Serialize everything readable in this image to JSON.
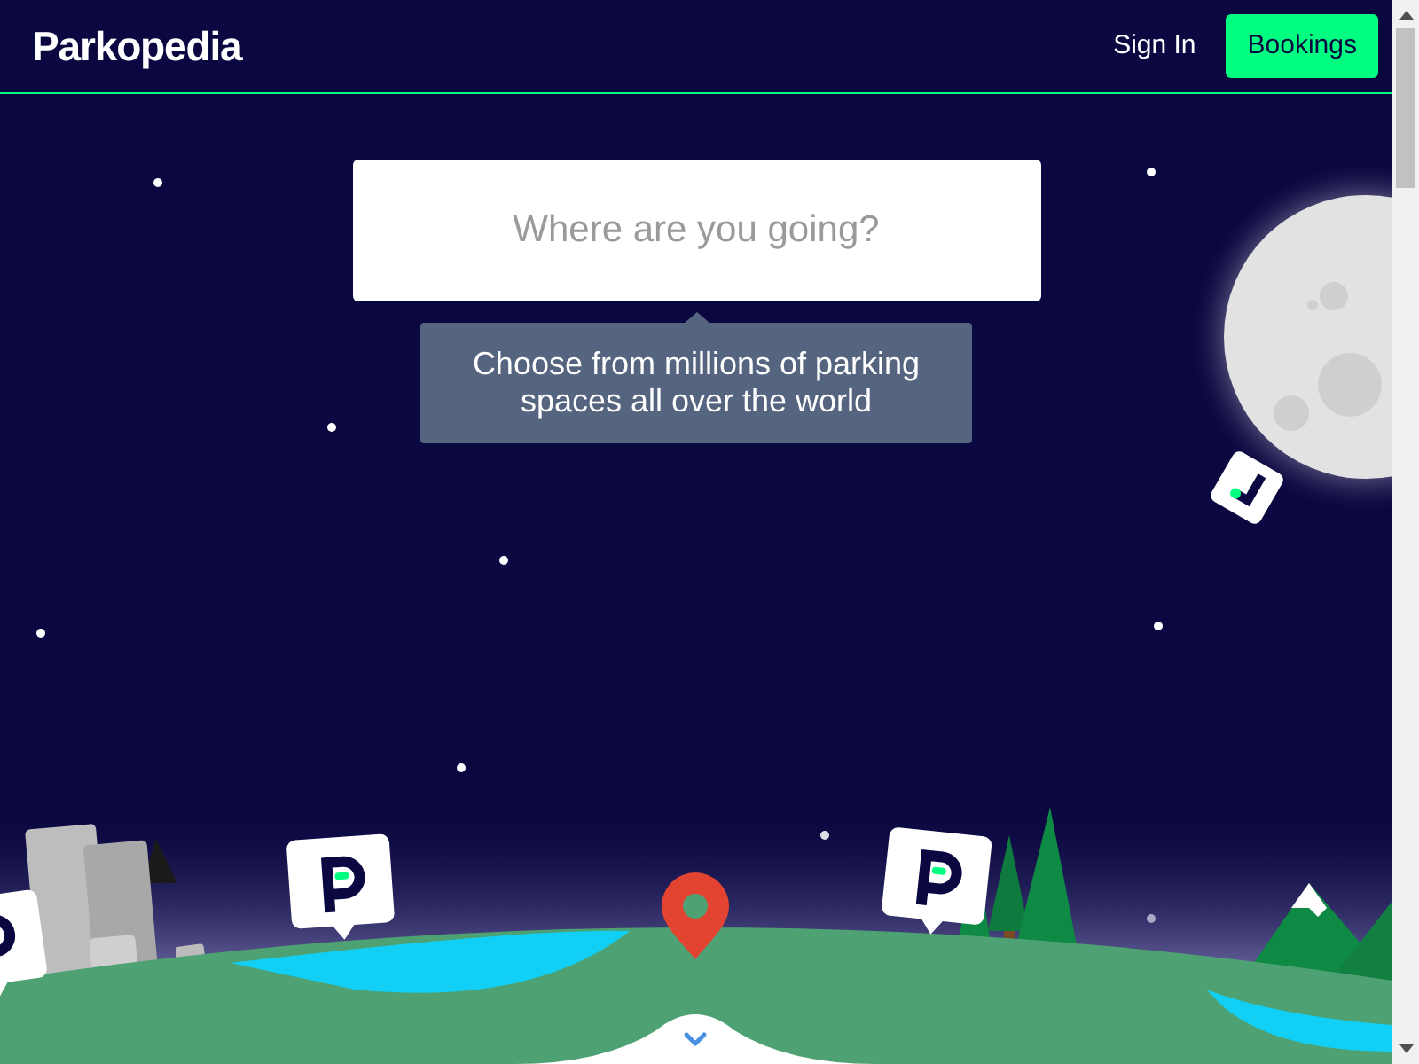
{
  "header": {
    "logo": "Parkopedia",
    "sign_in": "Sign In",
    "bookings": "Bookings"
  },
  "search": {
    "placeholder": "Where are you going?"
  },
  "tooltip": "Choose from millions of parking spaces all over the world"
}
